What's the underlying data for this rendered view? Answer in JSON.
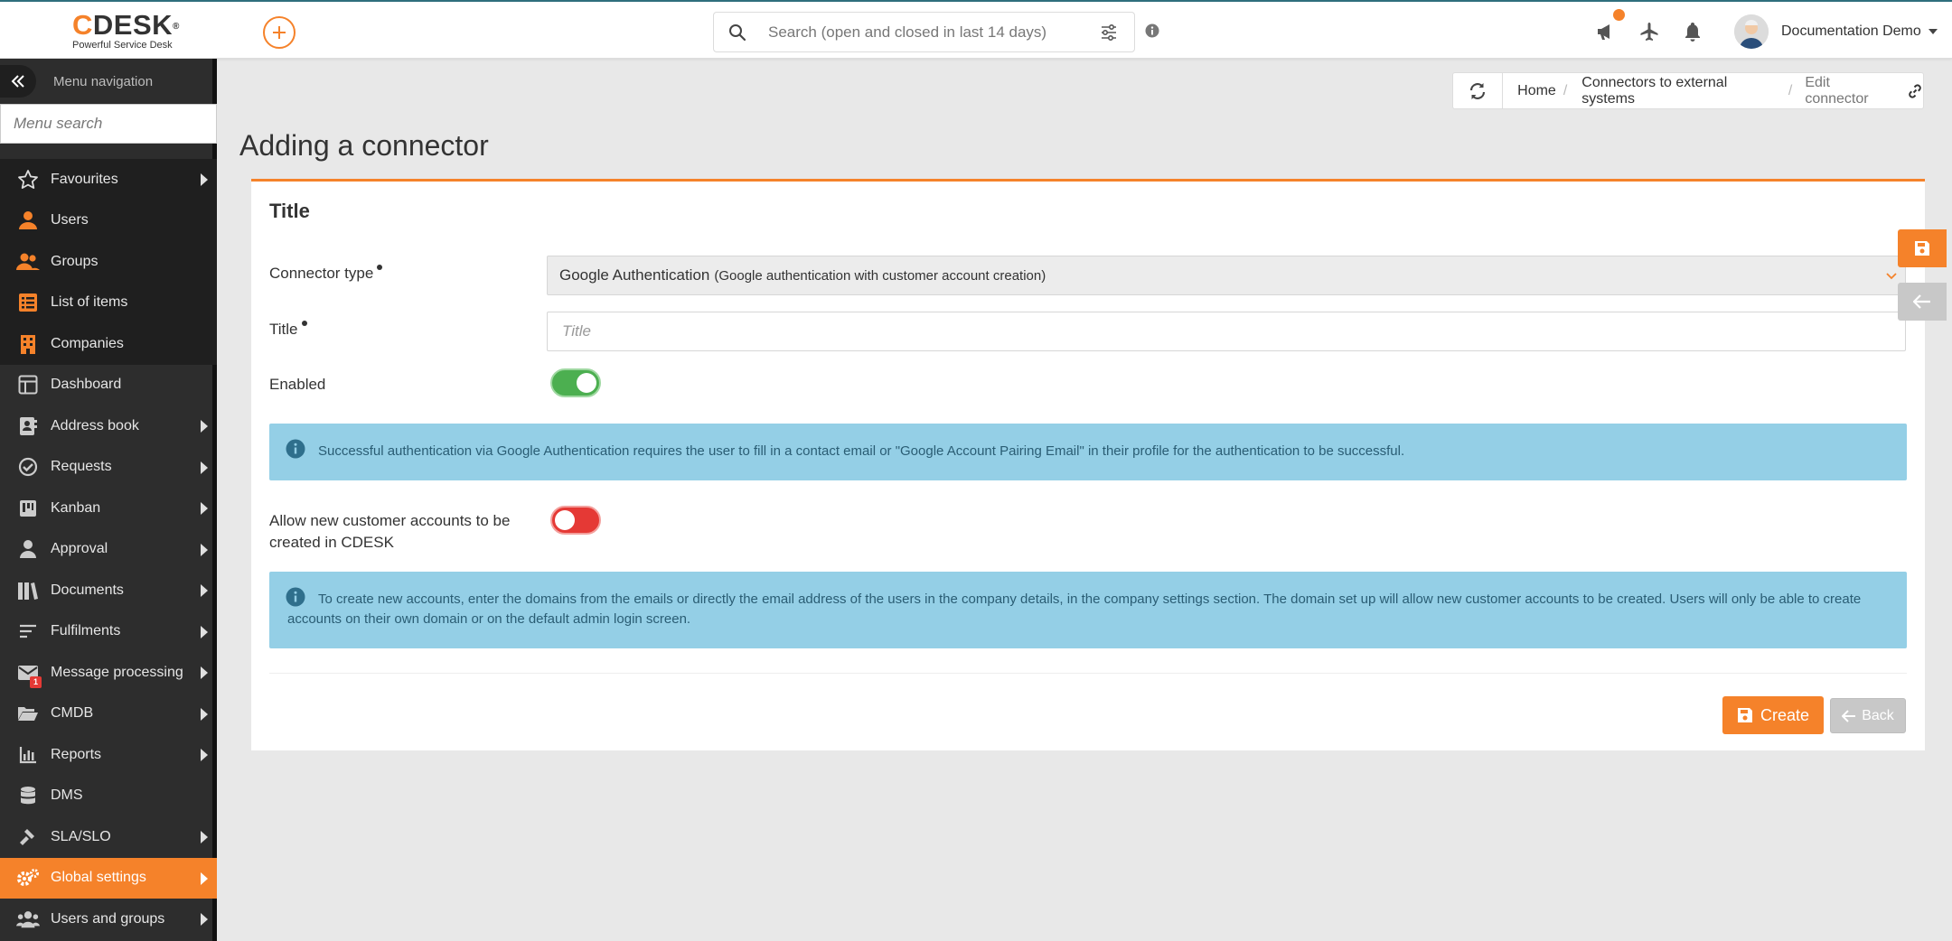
{
  "app": {
    "logo_text": "CDESK",
    "logo_reg": "®",
    "logo_subtitle": "Powerful Service Desk",
    "accent_color": "#f5822a"
  },
  "topbar": {
    "search_placeholder": "Search (open and closed in last 14 days)",
    "user_name": "Documentation Demo"
  },
  "sidebar": {
    "header_label": "Menu navigation",
    "search_placeholder": "Menu search",
    "items": [
      {
        "label": "Favourites",
        "icon": "star-icon",
        "submenu": true
      },
      {
        "label": "Users",
        "icon": "user-icon",
        "submenu": false
      },
      {
        "label": "Groups",
        "icon": "users-icon",
        "submenu": false
      },
      {
        "label": "List of items",
        "icon": "list-icon",
        "submenu": false
      },
      {
        "label": "Companies",
        "icon": "building-icon",
        "submenu": false
      },
      {
        "label": "Dashboard",
        "icon": "dashboard-icon",
        "submenu": false
      },
      {
        "label": "Address book",
        "icon": "address-book-icon",
        "submenu": true
      },
      {
        "label": "Requests",
        "icon": "requests-icon",
        "submenu": true
      },
      {
        "label": "Kanban",
        "icon": "kanban-icon",
        "submenu": true
      },
      {
        "label": "Approval",
        "icon": "approval-icon",
        "submenu": true
      },
      {
        "label": "Documents",
        "icon": "documents-icon",
        "submenu": true
      },
      {
        "label": "Fulfilments",
        "icon": "fulfilments-icon",
        "submenu": true
      },
      {
        "label": "Message processing",
        "icon": "envelope-icon",
        "submenu": true,
        "badge": "1"
      },
      {
        "label": "CMDB",
        "icon": "folder-open-icon",
        "submenu": true
      },
      {
        "label": "Reports",
        "icon": "chart-icon",
        "submenu": true
      },
      {
        "label": "DMS",
        "icon": "database-icon",
        "submenu": false
      },
      {
        "label": "SLA/SLO",
        "icon": "gavel-icon",
        "submenu": true
      },
      {
        "label": "Global settings",
        "icon": "gears-icon",
        "submenu": true,
        "active": true
      },
      {
        "label": "Users and groups",
        "icon": "users-groups-icon",
        "submenu": true
      }
    ]
  },
  "breadcrumb": {
    "home": "Home",
    "sep": "/",
    "parent": "Connectors to external systems",
    "current": "Edit connector"
  },
  "page": {
    "title": "Adding a connector"
  },
  "form": {
    "section_title": "Title",
    "connector_type_label": "Connector type",
    "connector_type_value": "Google Authentication",
    "connector_type_desc": "(Google authentication with customer account creation)",
    "title_label": "Title",
    "title_placeholder": "Title",
    "enabled_label": "Enabled",
    "enabled": true,
    "info_auth": "Successful authentication via Google Authentication requires the user to fill in a contact email or \"Google Account Pairing Email\" in their profile for the authentication to be successful.",
    "allow_label": "Allow new customer accounts to be created in CDESK",
    "allow_new_accounts": false,
    "info_domains": "To create new accounts, enter the domains from the emails or directly the email address of the users in the company details, in the company settings section. The domain set up will allow new customer accounts to be created. Users will only be able to create accounts on their own domain or on the default admin login screen.",
    "create_label": "Create",
    "back_label": "Back"
  }
}
